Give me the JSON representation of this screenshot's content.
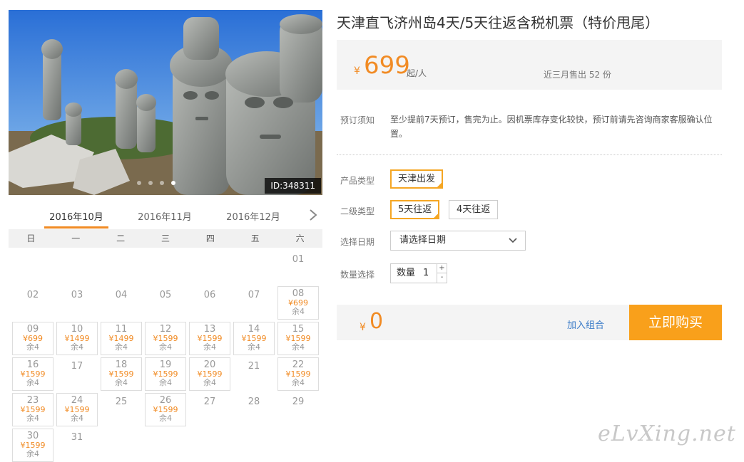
{
  "photo": {
    "id_label": "ID:348311"
  },
  "calendar": {
    "months": [
      "2016年10月",
      "2016年11月",
      "2016年12月"
    ],
    "weekdays": [
      "日",
      "一",
      "二",
      "三",
      "四",
      "五",
      "六"
    ],
    "days": [
      {
        "d": "01"
      },
      {
        "d": "02"
      },
      {
        "d": "03"
      },
      {
        "d": "04"
      },
      {
        "d": "05"
      },
      {
        "d": "06"
      },
      {
        "d": "07"
      },
      {
        "d": "08",
        "p": "¥699",
        "s": "余4"
      },
      {
        "d": "09",
        "p": "¥699",
        "s": "余4"
      },
      {
        "d": "10",
        "p": "¥1499",
        "s": "余4"
      },
      {
        "d": "11",
        "p": "¥1499",
        "s": "余4"
      },
      {
        "d": "12",
        "p": "¥1599",
        "s": "余4"
      },
      {
        "d": "13",
        "p": "¥1599",
        "s": "余4"
      },
      {
        "d": "14",
        "p": "¥1599",
        "s": "余4"
      },
      {
        "d": "15",
        "p": "¥1599",
        "s": "余4"
      },
      {
        "d": "16",
        "p": "¥1599",
        "s": "余4"
      },
      {
        "d": "17"
      },
      {
        "d": "18",
        "p": "¥1599",
        "s": "余4"
      },
      {
        "d": "19",
        "p": "¥1599",
        "s": "余4"
      },
      {
        "d": "20",
        "p": "¥1599",
        "s": "余4"
      },
      {
        "d": "21"
      },
      {
        "d": "22",
        "p": "¥1599",
        "s": "余4"
      },
      {
        "d": "23",
        "p": "¥1599",
        "s": "余4"
      },
      {
        "d": "24",
        "p": "¥1599",
        "s": "余4"
      },
      {
        "d": "25"
      },
      {
        "d": "26",
        "p": "¥1599",
        "s": "余4"
      },
      {
        "d": "27"
      },
      {
        "d": "28"
      },
      {
        "d": "29"
      },
      {
        "d": "30",
        "p": "¥1599",
        "s": "余4"
      },
      {
        "d": "31"
      }
    ]
  },
  "product": {
    "title": "天津直飞济州岛4天/5天往返含税机票（特价甩尾）",
    "currency": "¥",
    "price": "699",
    "price_unit": "起/人",
    "sold": "近三月售出 52 份"
  },
  "notice": {
    "label": "预订须知",
    "text": "至少提前7天预订，售完为止。因机票库存变化较快，预订前请先咨询商家客服确认位置。"
  },
  "options": {
    "type_label": "产品类型",
    "type_values": [
      "天津出发"
    ],
    "subtype_label": "二级类型",
    "subtype_values": [
      "5天往返",
      "4天往返"
    ],
    "date_label": "选择日期",
    "date_placeholder": "请选择日期",
    "qty_label": "数量选择",
    "qty_field_label": "数量",
    "qty_value": "1",
    "plus": "+",
    "minus": "-"
  },
  "buy": {
    "currency": "¥",
    "total": "0",
    "combo_label": "加入组合",
    "buy_label": "立即购买"
  },
  "watermark": "eLvXing.net",
  "colors": {
    "accent": "#f18b24",
    "buy_button": "#f9a01b",
    "link": "#3a7bc8"
  }
}
